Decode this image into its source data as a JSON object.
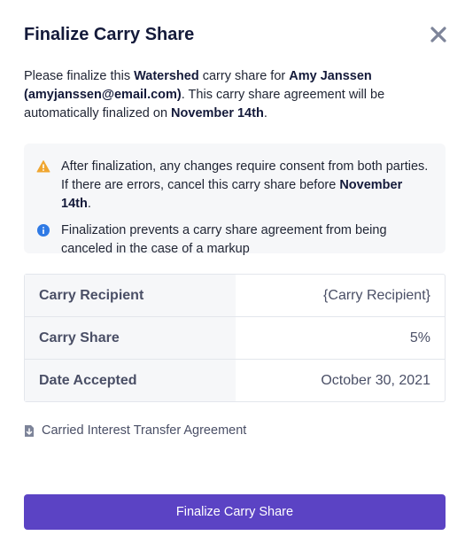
{
  "modal": {
    "title": "Finalize Carry Share",
    "close_icon": "close-icon"
  },
  "intro": {
    "t1": "Please finalize this ",
    "entity": "Watershed",
    "t2": " carry share for ",
    "recipient": "Amy Janssen (amyjanssen@email.com)",
    "t3": ". This carry share agreement will be automatically finalized on ",
    "date": "November 14th",
    "t4": "."
  },
  "notice": {
    "warning_icon": "warning-icon",
    "warning_text": "After finalization, any changes require consent from both parties. If there are errors, cancel this carry share before ",
    "warning_date": "November 14th",
    "warning_end": ".",
    "info_icon": "info-icon",
    "info_text": "Finalization prevents a carry share agreement from being canceled in the case of a markup"
  },
  "details": [
    {
      "label": "Carry Recipient",
      "value": "{Carry Recipient}"
    },
    {
      "label": "Carry Share",
      "value": "5%"
    },
    {
      "label": "Date Accepted",
      "value": "October 30, 2021"
    }
  ],
  "document": {
    "icon": "file-download-icon",
    "label": "Carried Interest Transfer Agreement"
  },
  "actions": {
    "finalize_label": "Finalize Carry Share"
  },
  "colors": {
    "primary": "#5b43c4",
    "warning": "#f0a630",
    "info": "#2f7ae5",
    "close": "#7d8499"
  }
}
